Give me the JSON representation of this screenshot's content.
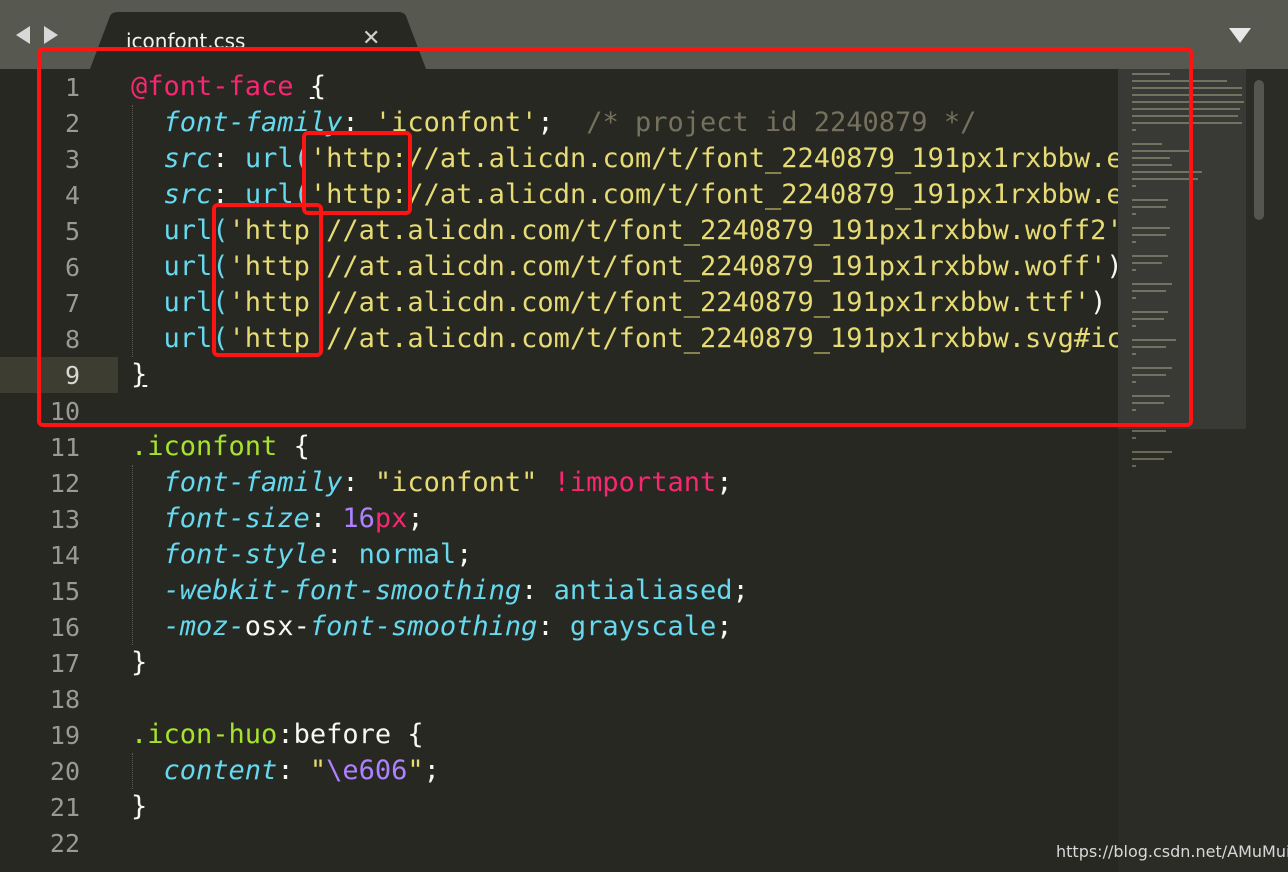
{
  "tab": {
    "title": "iconfont.css",
    "close_symbol": "✕"
  },
  "nav": {
    "back_icon": "chevron-left-icon",
    "forward_icon": "chevron-right-icon",
    "menu_icon": "dropdown-triangle-icon"
  },
  "line_numbers": [
    "1",
    "2",
    "3",
    "4",
    "5",
    "6",
    "7",
    "8",
    "9",
    "10",
    "11",
    "12",
    "13",
    "14",
    "15",
    "16",
    "17",
    "18",
    "19",
    "20",
    "21",
    "22"
  ],
  "current_line": "9",
  "code": {
    "l1": {
      "at_rule": "@font-face",
      "brace": "{"
    },
    "l2": {
      "prop": "font-family",
      "colon": ":",
      "value": "'iconfont'",
      "semi": ";",
      "comment": "/* project id 2240879 */"
    },
    "l3": {
      "prop": "src",
      "colon": ":",
      "fn": "url(",
      "value": "'http://at.alicdn.com/t/font_2240879_191px1rxbbw.e"
    },
    "l4": {
      "prop": "src",
      "colon": ":",
      "fn": "url(",
      "value": "'http://at.alicdn.com/t/font_2240879_191px1rxbbw.e"
    },
    "l5": {
      "fn": "url(",
      "value": "'http //at.alicdn.com/t/font_2240879_191px1rxbbw.woff2'"
    },
    "l6": {
      "fn": "url(",
      "value": "'http //at.alicdn.com/t/font_2240879_191px1rxbbw.woff'",
      "close": ")"
    },
    "l7": {
      "fn": "url(",
      "value": "'http //at.alicdn.com/t/font_2240879_191px1rxbbw.ttf'",
      "close": ")"
    },
    "l8": {
      "fn": "url(",
      "value": "'http //at.alicdn.com/t/font_2240879_191px1rxbbw.svg#ic"
    },
    "l9": {
      "brace": "}"
    },
    "l11": {
      "selector": ".iconfont",
      "brace": " {"
    },
    "l12": {
      "prop": "font-family",
      "colon": ": ",
      "value": "\"iconfont\"",
      "important": " !important",
      "semi": ";"
    },
    "l13": {
      "prop": "font-size",
      "colon": ": ",
      "num": "16",
      "unit": "px",
      "semi": ";"
    },
    "l14": {
      "prop": "font-style",
      "colon": ": ",
      "value": "normal",
      "semi": ";"
    },
    "l15": {
      "prop": "-webkit-font-smoothing",
      "colon": ": ",
      "value": "antialiased",
      "semi": ";"
    },
    "l16": {
      "prefix": "-moz-",
      "mid": "osx-",
      "prop": "font-smoothing",
      "colon": ": ",
      "value": "grayscale",
      "semi": ";"
    },
    "l17": {
      "brace": "}"
    },
    "l19": {
      "selector": ".icon-huo",
      "pseudo": ":before",
      "brace": " {"
    },
    "l20": {
      "prop": "content",
      "colon": ": ",
      "q1": "\"",
      "escape": "\\e606",
      "q2": "\"",
      "semi": ";"
    },
    "l21": {
      "brace": "}"
    }
  },
  "watermark": "https://blog.csdn.net/AMuMuion"
}
